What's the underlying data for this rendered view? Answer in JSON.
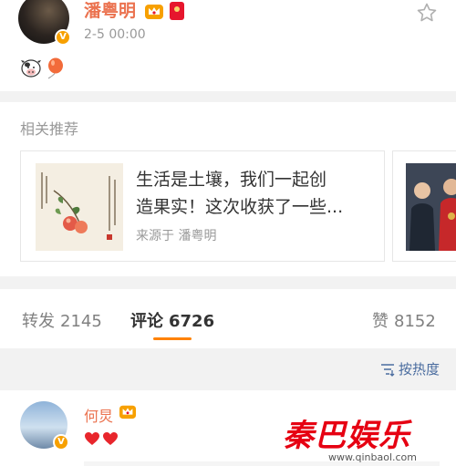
{
  "post": {
    "author": "潘粤明",
    "time": "2-5 00:00",
    "verified_badge": "V",
    "emojis": [
      "cow-emoji",
      "balloon-emoji"
    ]
  },
  "recommend": {
    "title": "相关推荐",
    "card": {
      "line1": "生活是土壤，我们一起创",
      "line2": "造果实！这次收获了一些...",
      "source": "来源于 潘粤明"
    }
  },
  "tabs": {
    "repost_label": "转发",
    "repost_count": "2145",
    "comment_label": "评论",
    "comment_count": "6726",
    "like_label": "赞",
    "like_count": "8152"
  },
  "sort": {
    "label": "按热度"
  },
  "comment": {
    "author": "何炅",
    "verified_badge": "V",
    "content_emojis": [
      "heart",
      "heart"
    ]
  },
  "watermark": {
    "logo": "秦巴娱乐",
    "url": "www.qinbaol.com"
  },
  "colors": {
    "accent": "#ff8200",
    "name": "#eb7350",
    "link": "#4a6c9f",
    "bg_gap": "#f2f2f2"
  }
}
